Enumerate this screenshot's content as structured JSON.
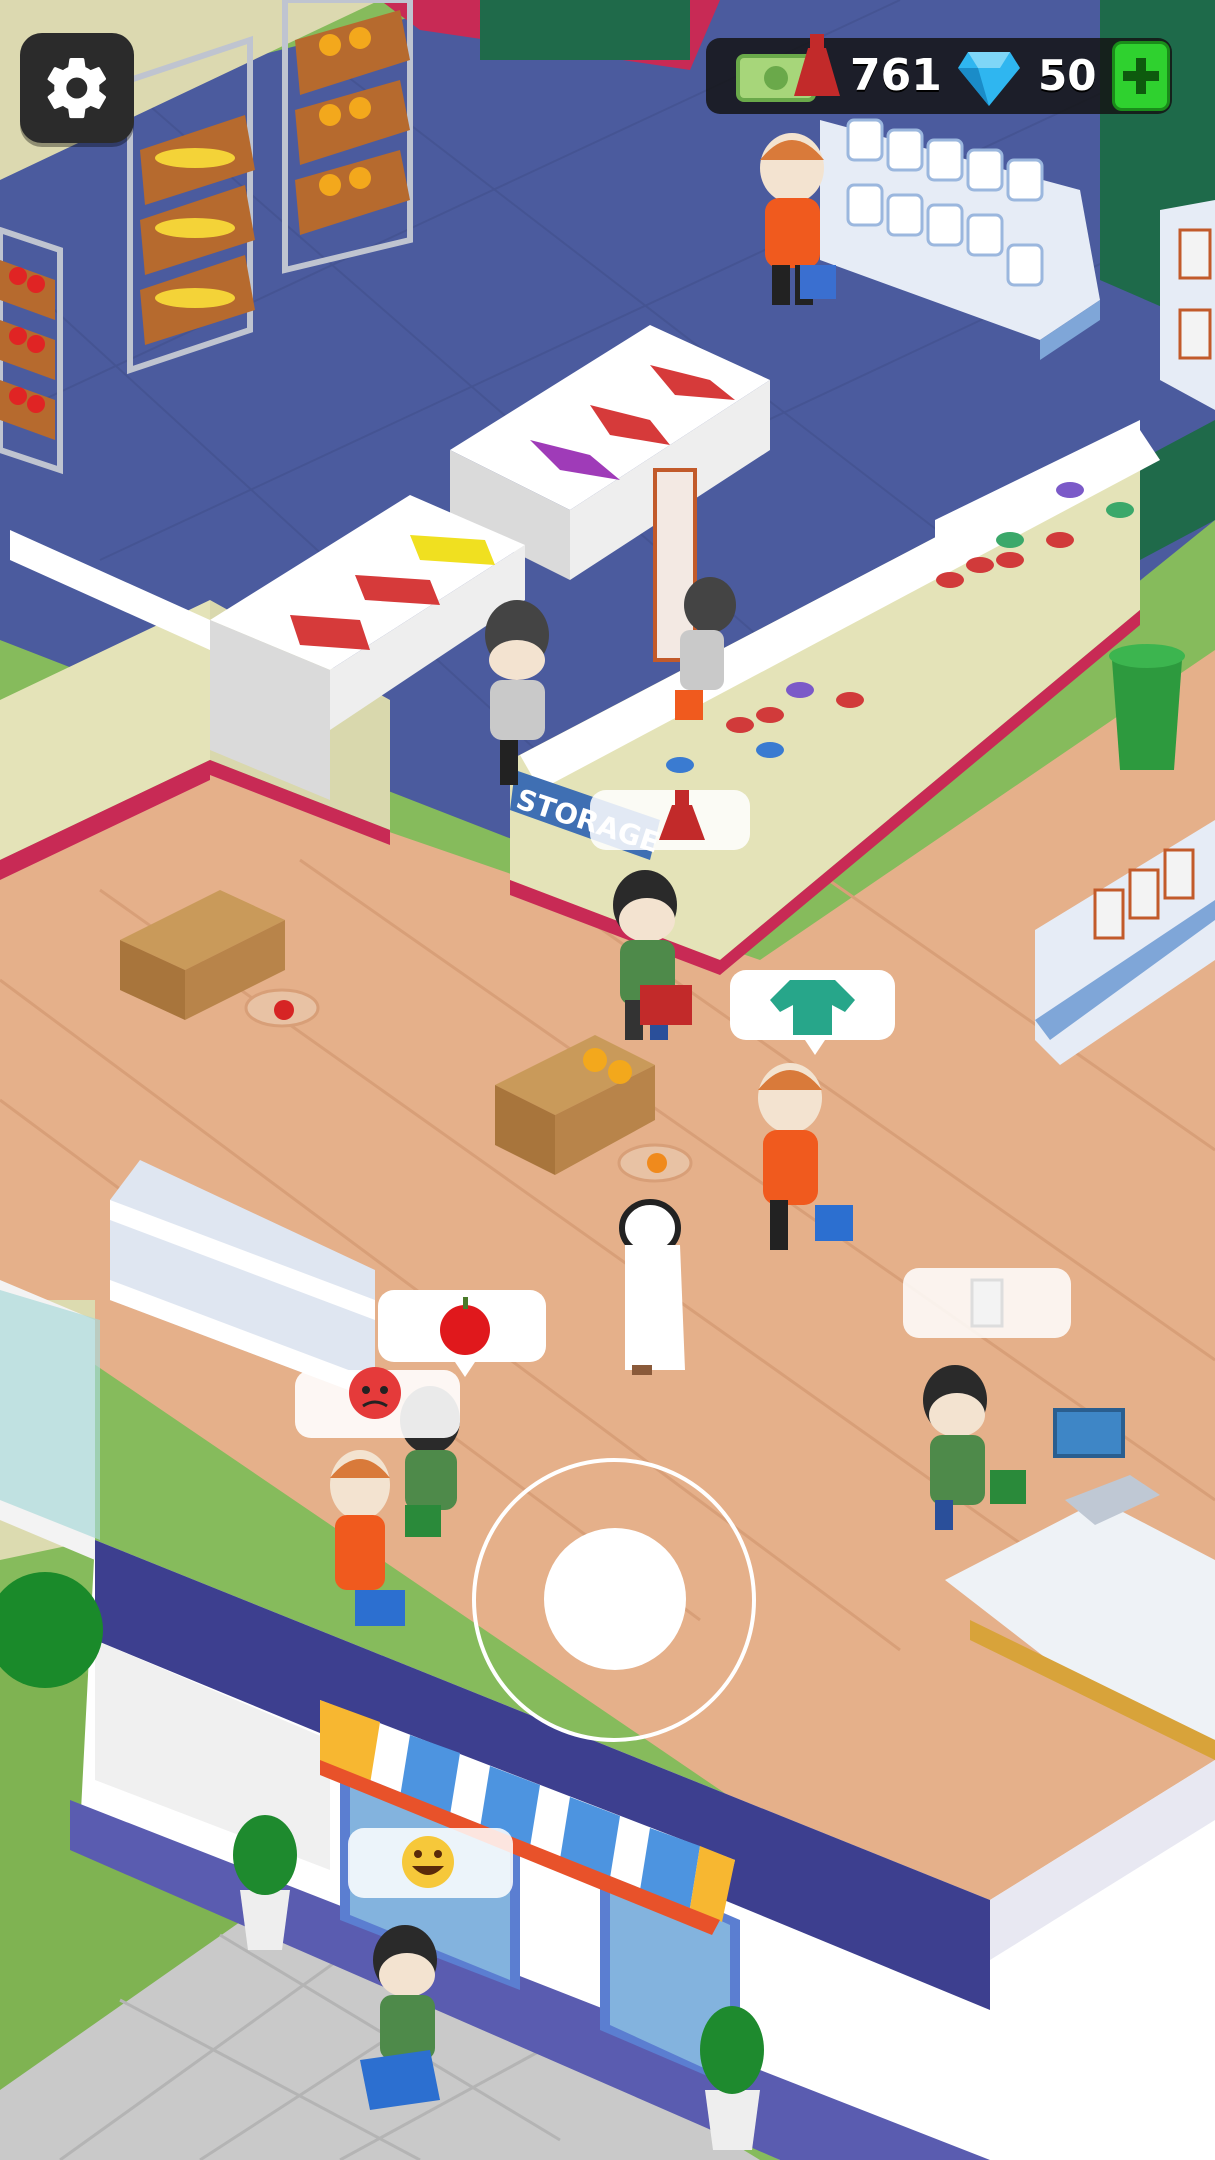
{
  "hud": {
    "cash_value": "761",
    "gems_value": "50",
    "settings_icon": "gear-icon",
    "add_gems_icon": "plus-icon"
  },
  "scene": {
    "storage_sign": "STORAGE",
    "bubbles": {
      "dress_request": "dress-icon",
      "shirt_request": "shirt-icon",
      "apple_request": "apple-icon",
      "milk_request": "milk-carton-icon",
      "angry_face": "angry-emoji-icon",
      "happy_face": "grinning-emoji-icon"
    }
  },
  "colors": {
    "floor_blue": "#4a5a9c",
    "floor_wood": "#e8b48a",
    "wall_pink": "#d8305a",
    "grass": "#7fb55a",
    "hud_dark": "#1e1e1e",
    "gem_plus_green": "#2fd12f"
  }
}
